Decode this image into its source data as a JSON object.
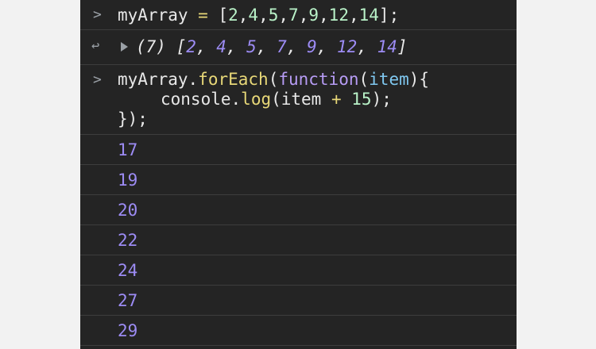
{
  "console": {
    "input1": {
      "prompt": ">",
      "variable": "myArray",
      "operator": " = ",
      "open": "[",
      "numbers": [
        "2",
        "4",
        "5",
        "7",
        "9",
        "12",
        "14"
      ],
      "close": "];"
    },
    "result1": {
      "return_icon": "↩",
      "count": "(7)",
      "open": "[",
      "values": [
        "2",
        "4",
        "5",
        "7",
        "9",
        "12",
        "14"
      ],
      "close": "]"
    },
    "input2": {
      "prompt": ">",
      "line1": {
        "obj": "myArray",
        "dot": ".",
        "method": "forEach",
        "open_paren": "(",
        "keyword": "function",
        "param_open": "(",
        "param": "item",
        "param_close": "){"
      },
      "line2": {
        "obj": "console",
        "dot": ".",
        "method": "log",
        "open": "(item ",
        "plus": "+",
        "space": " ",
        "num": "15",
        "close": ");"
      },
      "line3": "});"
    },
    "outputs": [
      "17",
      "19",
      "20",
      "22",
      "24",
      "27",
      "29"
    ]
  }
}
